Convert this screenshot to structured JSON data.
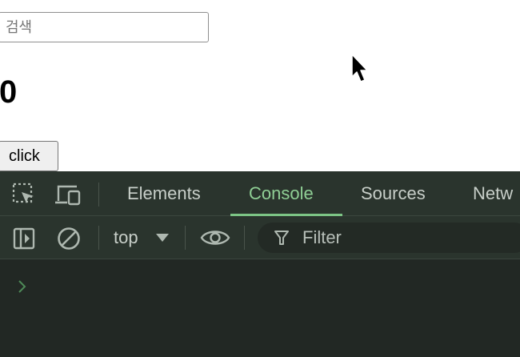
{
  "page": {
    "search": {
      "placeholder": "검색",
      "value": ""
    },
    "counter": "0",
    "button_label": "click"
  },
  "devtools": {
    "tabs": [
      {
        "label": "Elements",
        "active": false
      },
      {
        "label": "Console",
        "active": true
      },
      {
        "label": "Sources",
        "active": false
      },
      {
        "label": "Netw",
        "active": false
      }
    ],
    "toolbar": {
      "context": "top",
      "filter_placeholder": "Filter"
    },
    "icons": {
      "inspect": "inspect-element-icon",
      "device": "device-toolbar-icon",
      "sidebar": "show-sidebar-icon",
      "clear": "clear-console-icon",
      "dropdown": "dropdown-arrow-icon",
      "eye": "live-expression-eye-icon",
      "filter": "filter-funnel-icon",
      "prompt": "console-prompt-chevron-icon"
    },
    "colors": {
      "panel_bg": "#2a342d",
      "console_bg": "#222824",
      "accent": "#8fcf95",
      "text": "#c8cfc9"
    }
  }
}
